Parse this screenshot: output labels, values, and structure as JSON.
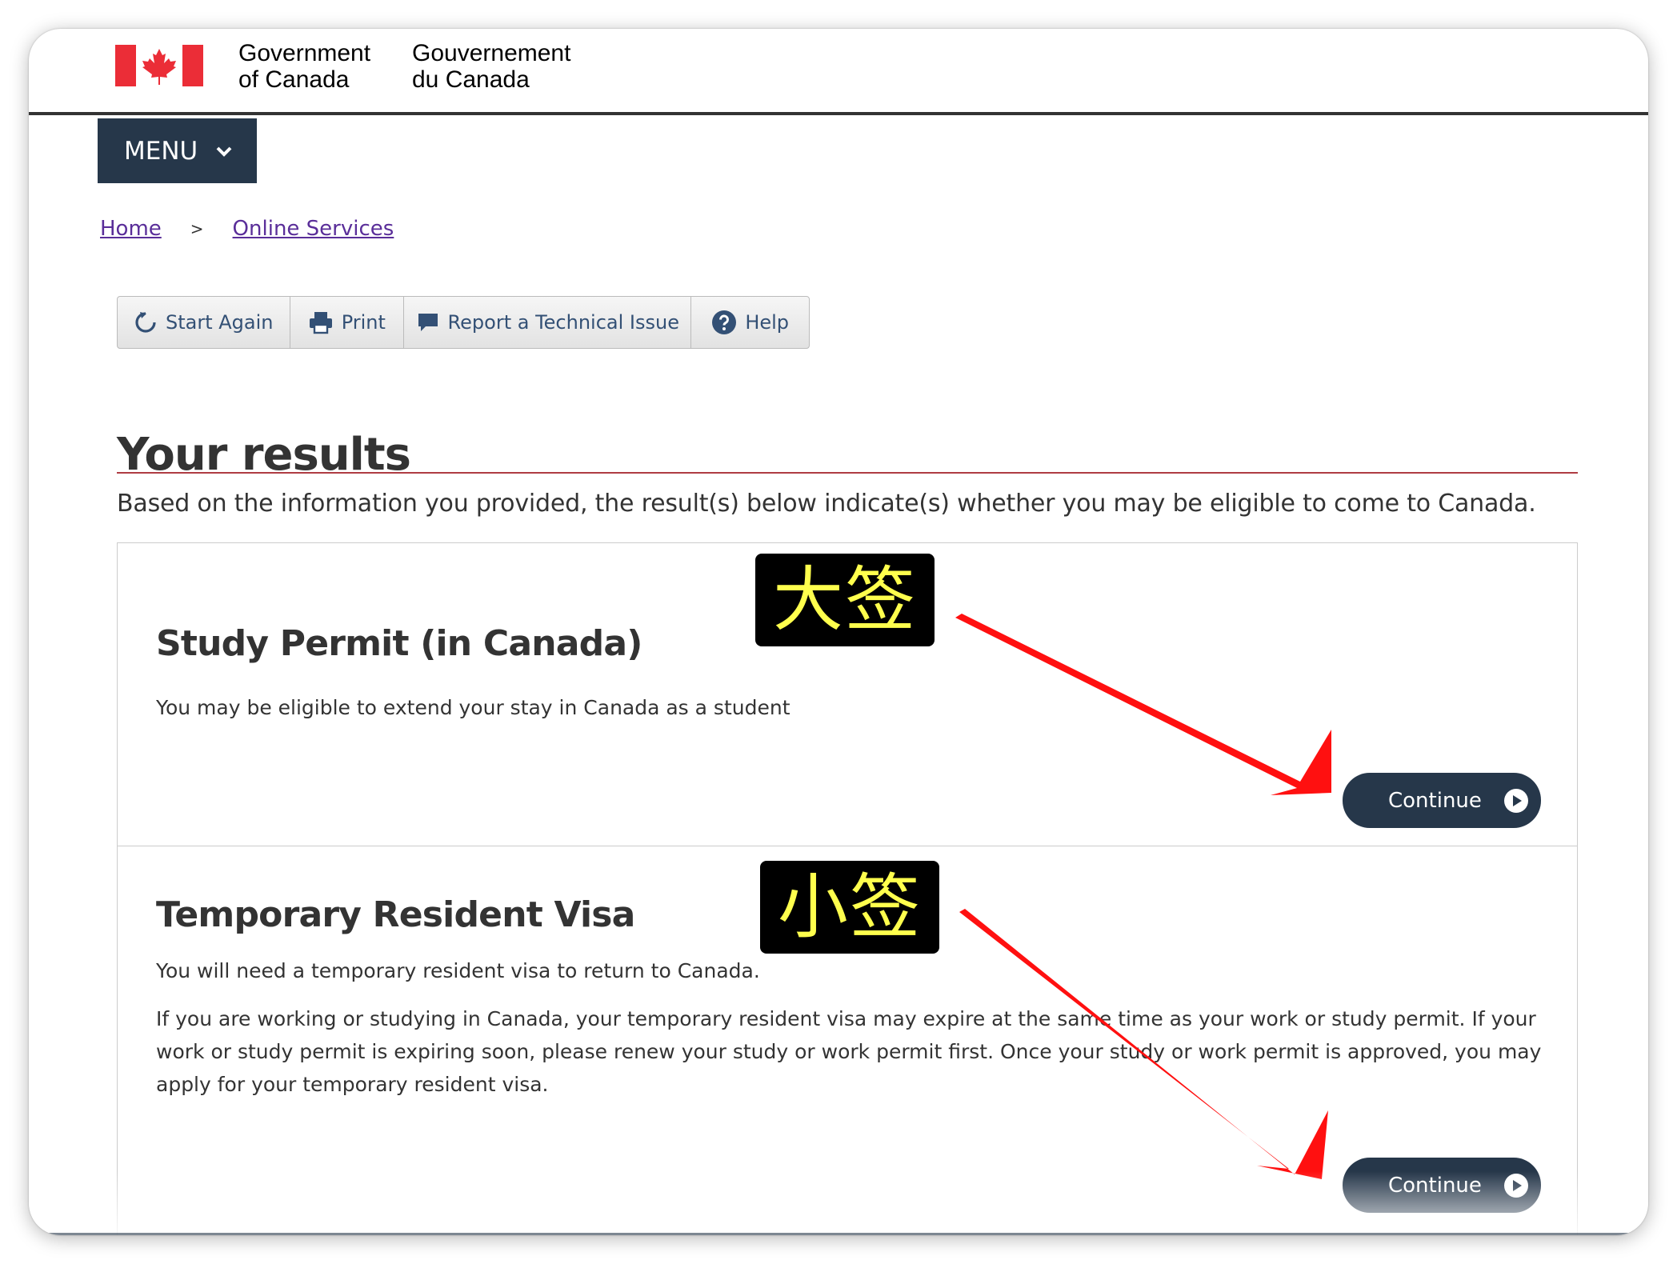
{
  "header": {
    "signature_en_line1": "Government",
    "signature_en_line2": "of Canada",
    "signature_fr_line1": "Gouvernement",
    "signature_fr_line2": "du Canada"
  },
  "menu": {
    "label": "MENU"
  },
  "breadcrumb": {
    "items": [
      "Home",
      "Online Services"
    ],
    "separator": ">"
  },
  "toolbar": {
    "items": [
      {
        "label": "Start Again",
        "icon": "refresh-icon"
      },
      {
        "label": "Print",
        "icon": "printer-icon"
      },
      {
        "label": "Report a Technical Issue",
        "icon": "speech-bubble-icon"
      },
      {
        "label": "Help",
        "icon": "question-circle-icon"
      }
    ]
  },
  "page": {
    "title": "Your results",
    "intro": "Based on the information you provided, the result(s) below indicate(s) whether you may be eligible to come to Canada."
  },
  "results": [
    {
      "title": "Study Permit (in Canada)",
      "text": "You may be eligible to extend your stay in Canada as a student",
      "button": "Continue",
      "annotation": "大签"
    },
    {
      "title": "Temporary Resident Visa",
      "text": "You will need a temporary resident visa to return to Canada.",
      "text2": "If you are working or studying in Canada, your temporary resident visa may expire at the same time as your work or study permit. If your work or study permit is expiring soon, please renew your study or work permit first. Once your study or work permit is approved, you may apply for your temporary resident visa.",
      "button": "Continue",
      "annotation": "小签"
    }
  ],
  "colors": {
    "nav_dark": "#26374a",
    "title_rule": "#af3c43",
    "link": "#5a2e99",
    "annotation_arrow": "#ff0000",
    "annotation_text": "#ffff4d"
  }
}
